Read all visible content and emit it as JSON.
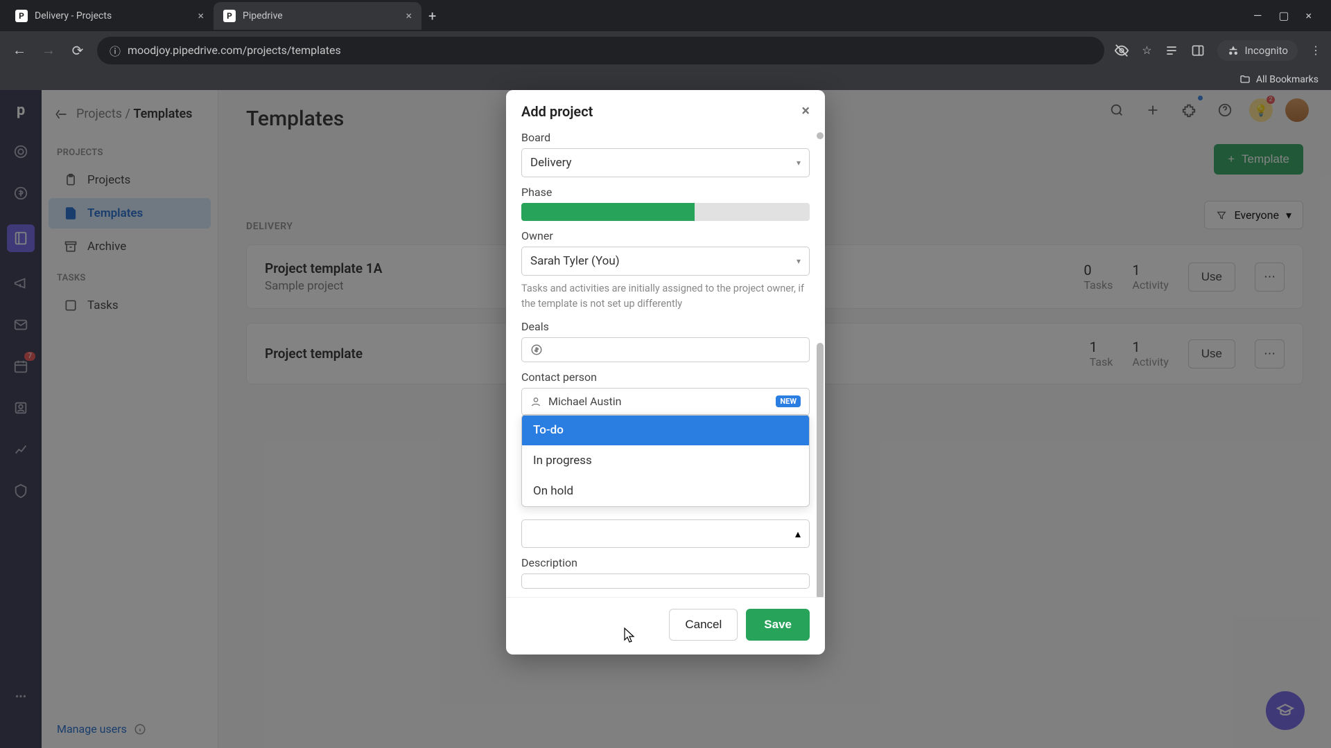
{
  "browser": {
    "tabs": [
      {
        "title": "Delivery - Projects"
      },
      {
        "title": "Pipedrive"
      }
    ],
    "url": "moodjoy.pipedrive.com/projects/templates",
    "incognito_label": "Incognito",
    "all_bookmarks": "All Bookmarks"
  },
  "breadcrumb": {
    "parent": "Projects",
    "current": "Templates"
  },
  "sidebar": {
    "section_projects": "PROJECTS",
    "items_projects": [
      "Projects",
      "Templates",
      "Archive"
    ],
    "section_tasks": "TASKS",
    "items_tasks": [
      "Tasks"
    ],
    "manage_users": "Manage users"
  },
  "content": {
    "title": "Templates",
    "template_button": "Template",
    "filter_label": "Everyone",
    "section_label": "DELIVERY",
    "cards": [
      {
        "title": "Project template 1A",
        "subtitle": "Sample project",
        "stat1_num": "0",
        "stat1_lbl": "Tasks",
        "stat2_num": "1",
        "stat2_lbl": "Activity",
        "use": "Use"
      },
      {
        "title": "Project template",
        "subtitle": "",
        "stat1_num": "1",
        "stat1_lbl": "Task",
        "stat2_num": "1",
        "stat2_lbl": "Activity",
        "use": "Use"
      }
    ]
  },
  "modal": {
    "title": "Add project",
    "labels": {
      "board": "Board",
      "phase": "Phase",
      "owner": "Owner",
      "deals": "Deals",
      "contact": "Contact person",
      "description": "Description"
    },
    "board_value": "Delivery",
    "owner_value": "Sarah Tyler (You)",
    "owner_helper": "Tasks and activities are initially assigned to the project owner, if the template is not set up differently",
    "contact_value": "Michael Austin",
    "contact_chip": "NEW",
    "status_options": [
      "To-do",
      "In progress",
      "On hold"
    ],
    "cancel": "Cancel",
    "save": "Save"
  },
  "rail_badge": "7"
}
